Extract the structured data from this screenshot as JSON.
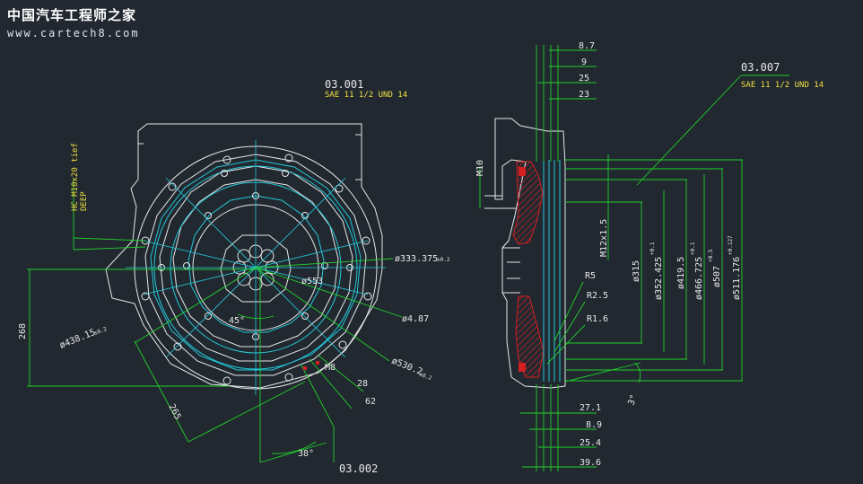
{
  "watermark": {
    "line1": "中国汽车工程师之家",
    "line2": "www.cartech8.com"
  },
  "colors": {
    "bg": "#212830",
    "white": "#e8e8e8",
    "yellow": "#f0e040",
    "green": "#22d02a",
    "cyan": "#24c8d8",
    "red": "#d42020"
  },
  "front_view": {
    "ref_title": "03.001",
    "ref_subtitle": "SAE 11 1/2 UND 14",
    "ref_bottom": "03.002",
    "hole_note": "HC M10x20 tief\nDEEP",
    "dim_333": "ø333.375",
    "tol_333": "±0.2",
    "dim_553": "ø553",
    "dim_487": "ø4.87",
    "dim_438": "ø438.15",
    "tol_438": "±0.2",
    "dim_530": "ø530.2",
    "tol_530": "±0.2",
    "dim_268": "268",
    "dim_265": "265",
    "dim_m8": "M8",
    "dim_28": "28",
    "dim_62": "62",
    "angle_45": "45°",
    "angle_38": "38°"
  },
  "side_view": {
    "ref_title": "03.007",
    "ref_subtitle": "SAE 11 1/2 UND 14",
    "dims_top": [
      "8.7",
      "9",
      "25",
      "23"
    ],
    "dims_bottom": [
      "27.1",
      "8.9",
      "25.4",
      "39.6"
    ],
    "dim_m10": "M10",
    "dim_m12": "M12x1.5",
    "dim_315": "ø315",
    "dim_352": "ø352.425",
    "tol_352": "+0.1",
    "dim_419": "ø419.5",
    "dim_466": "ø466.725",
    "tol_466": "+0.1",
    "dim_507": "ø507",
    "tol_507": "+0.5",
    "dim_511": "ø511.176",
    "tol_511": "+0.127",
    "radius_r5": "R5",
    "radius_r25": "R2.5",
    "radius_r16": "R1.6",
    "angle_3": "3°"
  }
}
